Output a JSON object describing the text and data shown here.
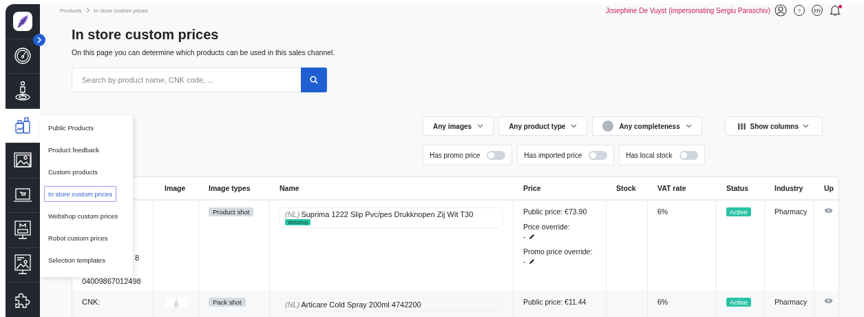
{
  "sidebar": {
    "items": [
      {
        "kind": "logo",
        "selected": false
      },
      {
        "kind": "gauge",
        "selected": false
      },
      {
        "kind": "person-target",
        "selected": false
      },
      {
        "kind": "products",
        "selected": true
      },
      {
        "kind": "image",
        "selected": false
      },
      {
        "kind": "laptop-cart",
        "selected": false
      },
      {
        "kind": "monitor",
        "selected": false
      },
      {
        "kind": "presentation",
        "selected": false
      },
      {
        "kind": "puzzle",
        "selected": false
      }
    ]
  },
  "flyout_menu": {
    "items": [
      {
        "label": "Public Products",
        "selected": false
      },
      {
        "label": "Product feedback",
        "selected": false
      },
      {
        "label": "Custom products",
        "selected": false
      },
      {
        "label": "In store custom prices",
        "selected": true
      },
      {
        "label": "Webshop custom prices",
        "selected": false
      },
      {
        "label": "Robot custom prices",
        "selected": false
      },
      {
        "label": "Selection templates",
        "selected": false
      }
    ]
  },
  "breadcrumb": [
    "Products",
    "In store custom prices"
  ],
  "header": {
    "user": "Josephine De Vuyst (impersonating Sergiu Paraschiv)",
    "help": "?",
    "language": "EN",
    "unread_notifications": true
  },
  "title": "In store custom prices",
  "subtitle": "On this page you can determine which products can be used in this sales channel.",
  "search": {
    "placeholder": "Search by product name, CNK code, ..."
  },
  "filters": {
    "dropdowns": [
      {
        "kind": "plain",
        "label": "Any images"
      },
      {
        "kind": "plain",
        "label": "Any product type"
      },
      {
        "kind": "dot",
        "label": "Any completeness"
      },
      {
        "kind": "columns",
        "label": "Show columns"
      }
    ],
    "toggles": [
      {
        "label": "Has promo price",
        "on": false
      },
      {
        "label": "Has imported price",
        "on": false
      },
      {
        "label": "Has local stock",
        "on": false
      }
    ]
  },
  "table": {
    "columns": [
      "",
      "Image",
      "Image types",
      "Name",
      "Price",
      "Stock",
      "VAT rate",
      "Status",
      "Industry",
      "Up"
    ],
    "rows": [
      {
        "column_1": [
          "8",
          "04009867012498"
        ],
        "has_image": false,
        "image_type": "Product shot",
        "language": "(NL)",
        "name": "Suprima 1222 Slip Pvc/pes Drukknopen Zij Wit T30",
        "channels": [
          "Webshop"
        ],
        "price_lines": [
          {
            "kind": "text",
            "text": "Public price: €73.90"
          },
          {
            "kind": "label",
            "text": "Price override:"
          },
          {
            "kind": "edit",
            "text": "-"
          },
          {
            "kind": "label",
            "text": "Promo price override:"
          },
          {
            "kind": "edit",
            "text": "-"
          }
        ],
        "stock": "",
        "vat": "6%",
        "status": "Active",
        "industry": "Pharmacy"
      },
      {
        "column_1": [
          "CNK:"
        ],
        "has_image": true,
        "image_type": "Pack shot",
        "language": "(NL)",
        "name": "Articare Cold Spray 200ml 4742200",
        "channels": [],
        "price_lines": [
          {
            "kind": "text",
            "text": "Public price: €11.44"
          }
        ],
        "stock": "",
        "vat": "6%",
        "status": "Active",
        "industry": "Pharmacy"
      }
    ]
  }
}
